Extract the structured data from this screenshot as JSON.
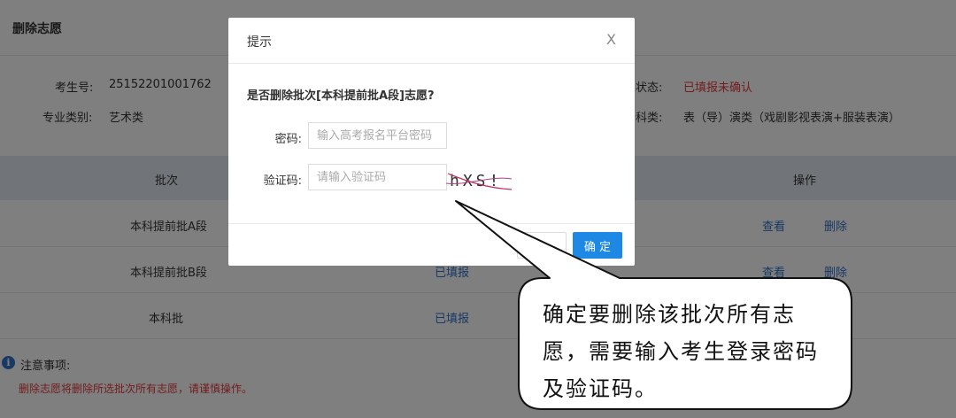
{
  "page": {
    "title": "删除志愿",
    "info": {
      "exam_no_label": "考生号:",
      "exam_no_value": "25152201001762",
      "major_type_label": "专业类别:",
      "major_type_value": "艺术类",
      "status_label_partial": "愿状态:",
      "status_value": "已填报未确认",
      "subject_label_partial": "牙科类:",
      "subject_value": "表（导）演类（戏剧影视表演+服装表演）"
    },
    "table": {
      "headers": {
        "batch": "批次",
        "action": "操作"
      },
      "rows": [
        {
          "batch": "本科提前批A段",
          "status": "",
          "view": "查看",
          "delete": "删除"
        },
        {
          "batch": "本科提前批B段",
          "status": "已填报",
          "view": "查看",
          "delete": "删除"
        },
        {
          "batch": "本科批",
          "status": "已填报",
          "view": "",
          "delete": ""
        }
      ]
    },
    "notes": {
      "icon": "i",
      "title": "注意事项:",
      "text": "删除志愿将删除所选批次所有志愿，请谨慎操作。"
    }
  },
  "modal": {
    "title": "提示",
    "close": "X",
    "question": "是否删除批次[本科提前批A段]志愿?",
    "password_label": "密码:",
    "password_placeholder": "输入高考报名平台密码",
    "captcha_label": "验证码:",
    "captcha_placeholder": "请输入验证码",
    "captcha_text": "hXS!",
    "cancel_label": "",
    "ok_label": "确 定"
  },
  "callout": {
    "line1": "确定要删除该批次所有志",
    "line2": "愿，需要输入考生登录密码",
    "line3": "及验证码。"
  },
  "colors": {
    "accent": "#1e88e5",
    "link": "#2f72c9",
    "danger": "#e4393c",
    "table_header_bg": "#e3eaf3"
  }
}
